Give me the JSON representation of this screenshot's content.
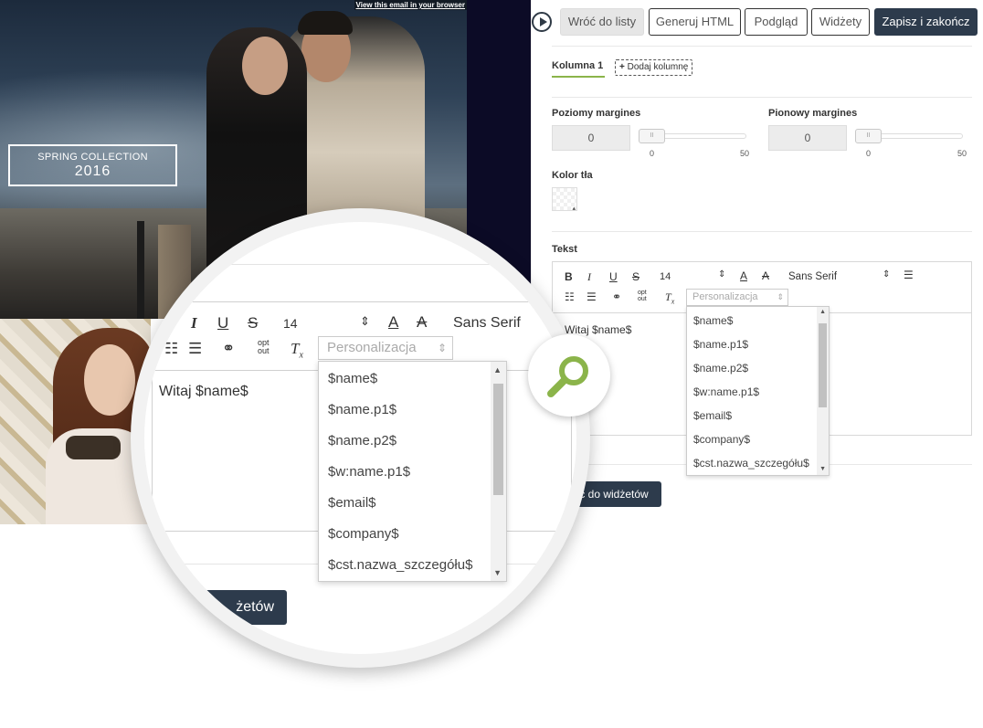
{
  "email": {
    "view_link": "View this email in your browser",
    "banner_line1": "SPRING COLLECTION",
    "banner_line2": "2016"
  },
  "toolbar": {
    "back_label": "Wróć do listy",
    "generate_html_label": "Generuj HTML",
    "preview_label": "Podgląd",
    "widgets_label": "Widżety",
    "save_close_label": "Zapisz i zakończ"
  },
  "columns": {
    "active_tab": "Kolumna 1",
    "add_label": "Dodaj kolumnę"
  },
  "margins": {
    "horizontal_label": "Poziomy margines",
    "horizontal_value": "0",
    "vertical_label": "Pionowy margines",
    "vertical_value": "0",
    "slider_min": "0",
    "slider_max": "50",
    "handle_glyph": "II"
  },
  "background": {
    "label": "Kolor tła"
  },
  "text_editor": {
    "label": "Tekst",
    "font_size": "14",
    "font_family": "Sans Serif",
    "personalization_placeholder": "Personalizacja",
    "opt_out_line1": "opt",
    "opt_out_line2": "out",
    "content": "Witaj $name$",
    "bold": "B",
    "italic": "I",
    "underline": "U",
    "strike": "S",
    "clear_format": "T"
  },
  "personalization_options": [
    "$name$",
    "$name.p1$",
    "$name.p2$",
    "$w:name.p1$",
    "$email$",
    "$company$",
    "$cst.nazwa_szczegółu$"
  ],
  "back_to_widgets_visible": "ć do widżetów",
  "magnified_back_to_widgets": "żetów",
  "colors": {
    "primary_dark": "#2d3b4c",
    "accent_green": "#8bb44a",
    "dark_band": "#0c0b26"
  },
  "icons": [
    "play-icon",
    "plus-icon",
    "link-icon",
    "list-icon",
    "ordered-list-icon",
    "align-icon",
    "font-color-icon",
    "highlight-icon",
    "search-icon"
  ]
}
